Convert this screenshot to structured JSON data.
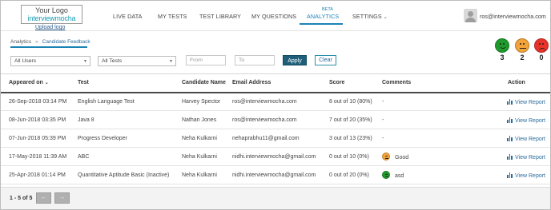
{
  "logo": {
    "top": "Your Logo",
    "bottom": "interviewmocha",
    "upload": "Upload logo"
  },
  "nav": {
    "items": [
      "LIVE DATA",
      "MY TESTS",
      "TEST LIBRARY",
      "MY QUESTIONS",
      "ANALYTICS",
      "SETTINGS"
    ],
    "active": "ANALYTICS",
    "badge": "BETA",
    "settings_caret": "⌄"
  },
  "user": {
    "email": "ros@interviewmocha.com"
  },
  "breadcrumb": {
    "root": "Analytics",
    "sep": "»",
    "current": "Candidate Feedback"
  },
  "filters": {
    "users": "All Users",
    "tests": "All Tests",
    "from_placeholder": "From",
    "to_placeholder": "To",
    "apply": "Apply",
    "clear": "Clear"
  },
  "summary": [
    {
      "mood": "happy",
      "color": "#1e9b2c",
      "count": "3"
    },
    {
      "mood": "neutral",
      "color": "#f2a33a",
      "count": "2"
    },
    {
      "mood": "sad",
      "color": "#e8332a",
      "count": "0"
    }
  ],
  "table": {
    "headers": [
      "Appeared on",
      "Test",
      "Candidate Name",
      "Email Address",
      "Score",
      "Comments",
      "Action"
    ],
    "sort_arrow": "⌄",
    "rows": [
      {
        "appeared": "26-Sep-2018 03:14 PM",
        "test": "English Language Test",
        "name": "Harvey Spector",
        "email": "ros@interviewmocha.com",
        "score": "8 out of 10 (80%)",
        "comment": "-",
        "mood": "",
        "action": "View Report"
      },
      {
        "appeared": "08-Jun-2018 03:35 PM",
        "test": "Java 8",
        "name": "Nathan Jones",
        "email": "ros@interviewmocha.com",
        "score": "7 out of 20 (35%)",
        "comment": "-",
        "mood": "",
        "action": "View Report"
      },
      {
        "appeared": "07-Jun-2018 05:39 PM",
        "test": "Progress Developer",
        "name": "Neha Kulkarni",
        "email": "nehaprabhu11@gmail.com",
        "score": "3 out of 13 (23%)",
        "comment": "-",
        "mood": "",
        "action": "View Report"
      },
      {
        "appeared": "17-May-2018 11:39 AM",
        "test": "ABC",
        "name": "Neha Kulkarni",
        "email": "nidhi.interviewmocha@gmail.com",
        "score": "0 out of 10 (0%)",
        "comment": "Good",
        "mood": "neutral",
        "action": "View Report"
      },
      {
        "appeared": "25-Apr-2018 01:14 PM",
        "test": "Quantitative Aptitude Basic (Inactive)",
        "name": "Neha Kulkarni",
        "email": "nidhi.interviewmocha@gmail.com",
        "score": "0 out of 20 (0%)",
        "comment": "asd",
        "mood": "happy",
        "action": "View Report"
      }
    ]
  },
  "pager": {
    "text": "1 - 5 of 5",
    "prev": "←",
    "next": "→"
  },
  "colors": {
    "accent": "#1a83b5",
    "apply_bg": "#1f5f7a",
    "link": "#2b6c9c"
  }
}
